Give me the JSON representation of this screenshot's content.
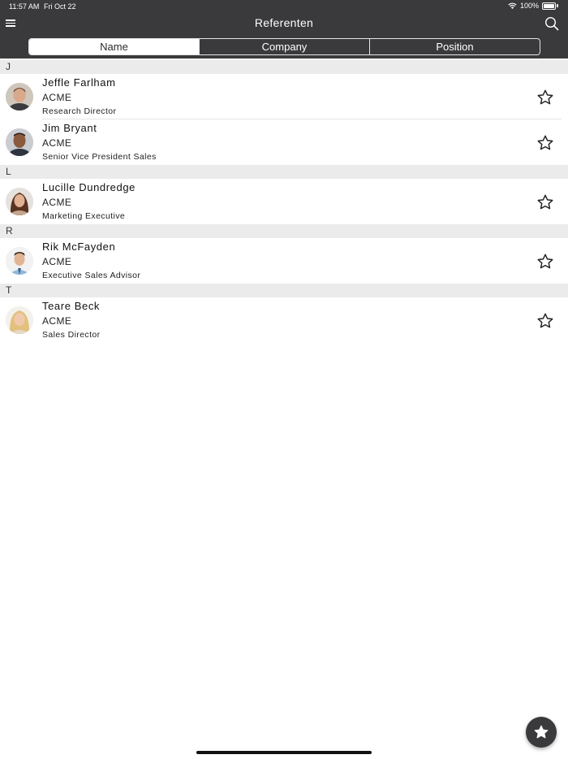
{
  "status_bar": {
    "time": "11:57 AM",
    "date": "Fri Oct 22",
    "battery": "100%",
    "icons": [
      "wifi-icon",
      "battery-icon"
    ]
  },
  "nav": {
    "title": "Referenten",
    "left_icon": "menu-icon",
    "right_icon": "search-icon"
  },
  "tabs": [
    {
      "label": "Name",
      "active": true
    },
    {
      "label": "Company",
      "active": false
    },
    {
      "label": "Position",
      "active": false
    }
  ],
  "sections": [
    {
      "letter": "J",
      "people": [
        {
          "name": "Jeffle Farlham",
          "company": "ACME",
          "position": "Research Director"
        },
        {
          "name": "Jim Bryant",
          "company": "ACME",
          "position": "Senior Vice President Sales"
        }
      ]
    },
    {
      "letter": "L",
      "people": [
        {
          "name": "Lucille Dundredge",
          "company": "ACME",
          "position": "Marketing Executive"
        }
      ]
    },
    {
      "letter": "R",
      "people": [
        {
          "name": "Rik McFayden",
          "company": "ACME",
          "position": "Executive Sales Advisor"
        }
      ]
    },
    {
      "letter": "T",
      "people": [
        {
          "name": "Teare Beck",
          "company": "ACME",
          "position": "Sales Director"
        }
      ]
    }
  ],
  "favorite_icon": "star-outline-icon",
  "fab_icon": "star-filled-icon",
  "colors": {
    "bar": "#3a3a3c",
    "section": "#ebebeb",
    "accent": "#ffffff"
  }
}
